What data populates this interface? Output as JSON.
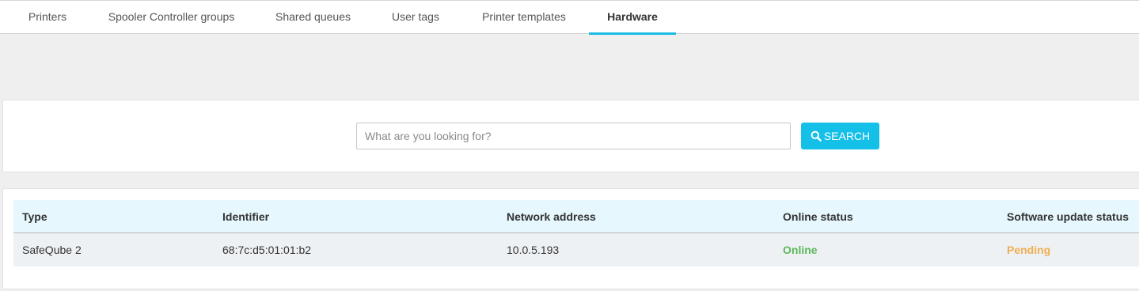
{
  "tabs": [
    {
      "label": "Printers",
      "active": false
    },
    {
      "label": "Spooler Controller groups",
      "active": false
    },
    {
      "label": "Shared queues",
      "active": false
    },
    {
      "label": "User tags",
      "active": false
    },
    {
      "label": "Printer templates",
      "active": false
    },
    {
      "label": "Hardware",
      "active": true
    }
  ],
  "search": {
    "placeholder": "What are you looking for?",
    "value": "",
    "button_label": "SEARCH",
    "button_icon": "search-icon"
  },
  "table": {
    "headers": [
      "Type",
      "Identifier",
      "Network address",
      "Online status",
      "Software update status"
    ],
    "rows": [
      {
        "type": "SafeQube 2",
        "identifier": "68:7c:d5:01:01:b2",
        "network_address": "10.0.5.193",
        "online_status": "Online",
        "software_update_status": "Pending"
      }
    ]
  },
  "colors": {
    "accent": "#1bbde6",
    "online": "#5cb85c",
    "pending": "#f0ad4e"
  }
}
